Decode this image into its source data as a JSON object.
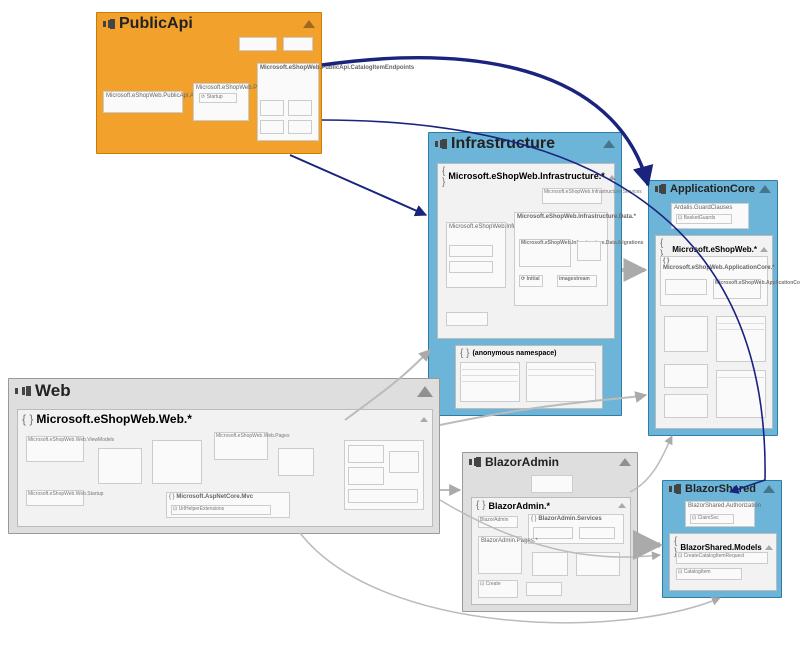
{
  "modules": {
    "publicApi": {
      "title": "PublicApi",
      "items": {
        "auth": "Microsoft.eShopWeb.PublicApi.AuthEndpoints",
        "root": "Microsoft.eShopWeb.PublicApi",
        "catalog": "Microsoft.eShopWeb.PublicApi.CatalogItemEndpoints",
        "startup": "Startup"
      }
    },
    "infrastructure": {
      "title": "Infrastructure",
      "ns": "Microsoft.eShopWeb.Infrastructure.*",
      "data_ns": "Microsoft.eShopWeb.Infrastructure.Data.*",
      "migrations": "Microsoft.eShopWeb.Infrastructure.Data.Migrations",
      "identity": "Microsoft.eShopWeb.Infrastructure.Identity",
      "anon_ns": "(anonymous namespace)",
      "initial": "Initial",
      "imagestream": "imagestream"
    },
    "applicationCore": {
      "title": "ApplicationCore",
      "guard": "Ardalis.GuardClauses",
      "basket": "BasketGuards",
      "ns": "Microsoft.eShopWeb.*",
      "core_ns": "Microsoft.eShopWeb.ApplicationCore.*",
      "entities": "Microsoft.eShopWeb.ApplicationCore.Entities"
    },
    "web": {
      "title": "Web",
      "ns": "Microsoft.eShopWeb.Web.*",
      "mvc": "Microsoft.AspNetCore.Mvc",
      "helper": "UrlHelperExtensions",
      "startup": "Microsoft.eShopWeb.Web.Startup"
    },
    "blazorAdmin": {
      "title": "BlazorAdmin",
      "ns": "BlazorAdmin.*",
      "services": "BlazorAdmin.Services",
      "pages": "BlazorAdmin.Pages.*",
      "auth": "BlazorAdmin",
      "create": "Create"
    },
    "blazorShared": {
      "title": "BlazorShared",
      "auth": "BlazorShared.Authorization",
      "usersvc": "ClaimSvc",
      "models": "BlazorShared.Models",
      "req": "CreateCatalogItemRequest",
      "item": "CatalogItem"
    }
  }
}
